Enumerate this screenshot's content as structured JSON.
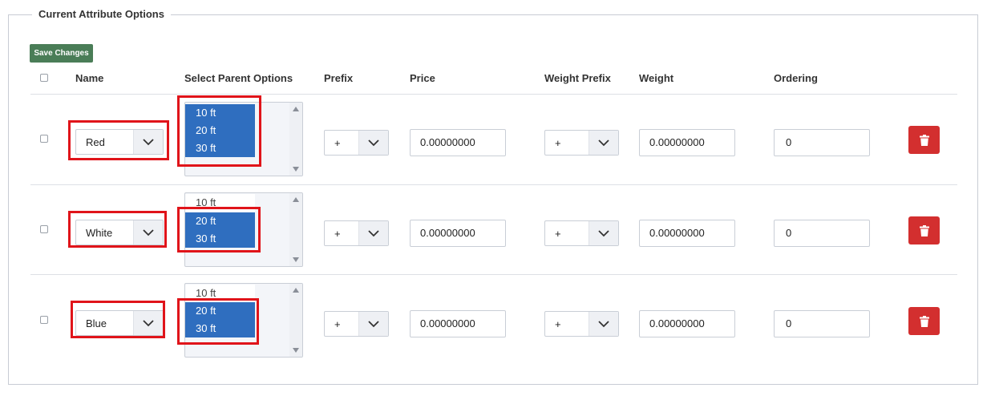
{
  "section": {
    "title": "Current Attribute Options"
  },
  "toolbar": {
    "save_label": "Save Changes"
  },
  "columns": {
    "name": "Name",
    "parent": "Select Parent Options",
    "prefix": "Prefix",
    "price": "Price",
    "weight_prefix": "Weight Prefix",
    "weight": "Weight",
    "ordering": "Ordering"
  },
  "rows": [
    {
      "name": "Red",
      "parent_options": [
        {
          "label": "10 ft",
          "selected": true
        },
        {
          "label": "20 ft",
          "selected": true
        },
        {
          "label": "30 ft",
          "selected": true
        }
      ],
      "prefix": "+",
      "price": "0.00000000",
      "weight_prefix": "+",
      "weight": "0.00000000",
      "ordering": "0"
    },
    {
      "name": "White",
      "parent_options": [
        {
          "label": "10 ft",
          "selected": false
        },
        {
          "label": "20 ft",
          "selected": true
        },
        {
          "label": "30 ft",
          "selected": true
        }
      ],
      "prefix": "+",
      "price": "0.00000000",
      "weight_prefix": "+",
      "weight": "0.00000000",
      "ordering": "0"
    },
    {
      "name": "Blue",
      "parent_options": [
        {
          "label": "10 ft",
          "selected": false
        },
        {
          "label": "20 ft",
          "selected": true
        },
        {
          "label": "30 ft",
          "selected": true
        }
      ],
      "prefix": "+",
      "price": "0.00000000",
      "weight_prefix": "+",
      "weight": "0.00000000",
      "ordering": "0"
    }
  ],
  "colors": {
    "save_button": "#4a7d57",
    "delete_button": "#d32f2f",
    "selected_option": "#2f6ebf",
    "highlight": "#e0141a"
  },
  "icons": {
    "dropdown": "chevron-down-icon",
    "delete": "trash-icon"
  }
}
